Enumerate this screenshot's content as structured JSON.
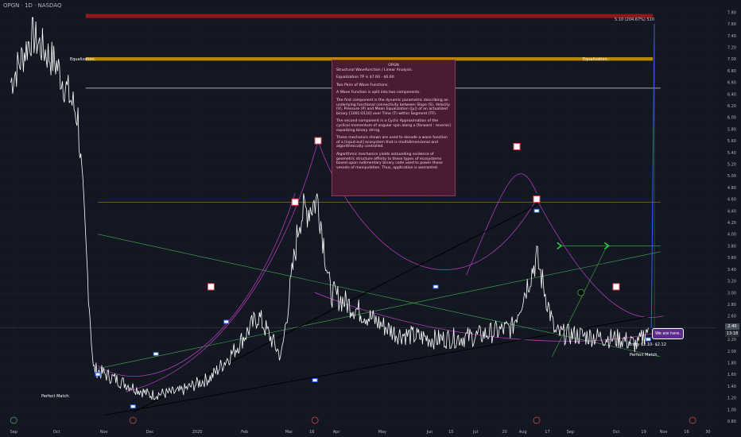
{
  "symbol_line": "OPGN · 1D · NASDAQ",
  "chart_data": {
    "type": "line",
    "title": "",
    "price_ticks": [
      "7.80",
      "7.60",
      "7.40",
      "7.20",
      "7.00",
      "6.80",
      "6.60",
      "6.40",
      "6.20",
      "6.00",
      "5.80",
      "5.60",
      "5.40",
      "5.20",
      "5.00",
      "4.80",
      "4.60",
      "4.40",
      "4.20",
      "4.00",
      "3.80",
      "3.60",
      "3.40",
      "3.20",
      "3.00",
      "2.80",
      "2.60",
      "2.40",
      "2.20",
      "2.00",
      "1.80",
      "1.60",
      "1.40",
      "1.20",
      "1.00",
      "0.80"
    ],
    "time_ticks": [
      "Sep",
      "Oct",
      "Nov",
      "Dec",
      "2020",
      "Feb",
      "Mar",
      "16",
      "Apr",
      "May",
      "Jun",
      "15",
      "Jul",
      "20",
      "Aug",
      "17",
      "Sep",
      "Oct",
      "19",
      "Nov",
      "16",
      "30"
    ],
    "ylim": [
      0.8,
      7.9
    ],
    "series": [
      {
        "values": [
          {
            "date": "2019-09-01",
            "close": 6.6
          },
          {
            "date": "2019-09-15",
            "close": 7.4
          },
          {
            "date": "2019-10-01",
            "close": 6.9
          },
          {
            "date": "2019-10-15",
            "close": 6.0
          },
          {
            "date": "2019-10-25",
            "close": 1.7
          },
          {
            "date": "2019-11-10",
            "close": 1.5
          },
          {
            "date": "2019-12-01",
            "close": 1.25
          },
          {
            "date": "2019-12-20",
            "close": 1.3
          },
          {
            "date": "2020-01-10",
            "close": 1.55
          },
          {
            "date": "2020-01-25",
            "close": 2.0
          },
          {
            "date": "2020-02-10",
            "close": 2.6
          },
          {
            "date": "2020-02-25",
            "close": 1.9
          },
          {
            "date": "2020-03-08",
            "close": 4.3
          },
          {
            "date": "2020-03-20",
            "close": 4.6
          },
          {
            "date": "2020-03-28",
            "close": 3.0
          },
          {
            "date": "2020-04-15",
            "close": 2.7
          },
          {
            "date": "2020-05-10",
            "close": 2.3
          },
          {
            "date": "2020-06-05",
            "close": 2.2
          },
          {
            "date": "2020-07-01",
            "close": 2.25
          },
          {
            "date": "2020-07-25",
            "close": 2.4
          },
          {
            "date": "2020-08-10",
            "close": 3.6
          },
          {
            "date": "2020-08-22",
            "close": 2.3
          },
          {
            "date": "2020-09-15",
            "close": 2.25
          },
          {
            "date": "2020-10-05",
            "close": 2.2
          },
          {
            "date": "2020-10-15",
            "close": 2.1
          },
          {
            "date": "2020-10-22",
            "close": 2.4
          }
        ]
      }
    ]
  },
  "equalization_zone": {
    "label_left": "Equalization.",
    "label_right": "Equalization."
  },
  "top_target": {
    "label": "5.10 (204.67%) 510"
  },
  "current_price": {
    "value": "2.40",
    "countdown": "13:18"
  },
  "annotations": {
    "perfect_match_left": "Perfect Match.",
    "perfect_match_right": "Perfect Match.",
    "entry": "Entry $2.10- $2.12",
    "we_are_here": "We are here."
  },
  "note": {
    "title": "OPGN",
    "subtitle": "Structural Wavefunction / Linear Analysis.",
    "target": "Equalization TP is $7.60 - $6.60",
    "pairs": "Two Pairs of Wave Functions.",
    "split": "A Wave Function is split into two components.",
    "first": "The first component is the dynamic parametric describing an underlying functional connectivity between Slope (S), Velocity (V), Pressure (P) and Mean Equalization (|μ|) of an actualized binary [1001:0110] over Time (T) within Segment (TF).",
    "second": "The second component is a Cyclic Approximation of the cyclical momentum of angular spin along a [forward : reverse] equalizing binary string.",
    "third": "These mechanics shown are used to decode a wave function of a [input:out] ecosystem that is multidimensional and algorithmically controlled.",
    "fourth": "Algorithmic mechanics yields astounding evidence of geometric structure affinity to these types of ecosystems based upon rudimentary binary code used to power these vessels of manipulation. Thus, application is warranted."
  },
  "colors": {
    "background": "#131722",
    "price_line": "#ffffff",
    "resistance_band": "#8b1a1a",
    "equalization_band": "#b8860b",
    "wave_purple": "#c43fc4",
    "wave_green": "#4caf50",
    "note_bg": "#4b1a33",
    "marker_red": "#e04a4a",
    "marker_blue": "#2962ff"
  }
}
